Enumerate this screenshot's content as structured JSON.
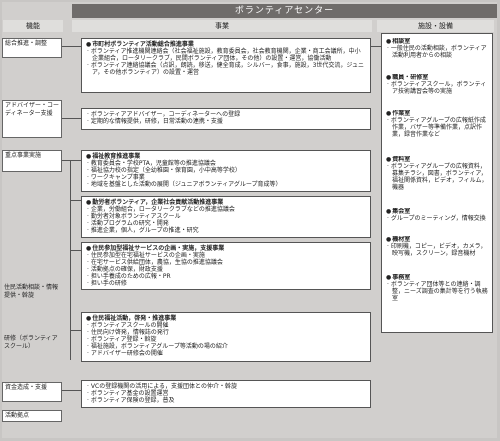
{
  "title": "ボランティアセンター",
  "headers": {
    "func": "機能",
    "business": "事業",
    "facility": "施設・設備"
  },
  "labels": {
    "coordination": "総合推進・調整",
    "advisor": "アドバイザー・コーディネーター支援",
    "priority": "重点事業実施",
    "info": "住民活動相談・情報提供・斡旋",
    "training": "研修（ボランティアスクール）",
    "funds": "資金造成・支援",
    "base": "活動拠点"
  },
  "boxes": [
    {
      "head": "市町村ボランティア活動総合推進事業",
      "items": [
        "ボランティア推進機関連絡会（社会福祉施設，教育委員会，社会教育機関，企業・商工会議所，中小企業組合，ロータリークラブ，民間ボランティア団体，その他）の設置・運営，協働活動",
        "ボランティア連絡協議会（点訳，朗読，移送，健全育成，シルバー，食事，施設，3世代交流，ジュニア，その他ボランティア）の設置・運営"
      ]
    },
    {
      "head": "",
      "items": [
        "ボランティアアドバイザー，コーディネーターへの登録",
        "定期的な情報提供，研修，日常活動の連携・支援"
      ]
    },
    {
      "head": "福祉教育推進事業",
      "items": [
        "教育委員会・学校PTA，児童館等の推進協議会",
        "福祉協力校の指定（全幼稚園・保育園，小中高等学校）",
        "ワークキャンプ事業",
        "地域を基盤とした活動の展開（ジュニアボランティアグループ育成等）"
      ]
    },
    {
      "head": "勤労者ボランティア，企業社会貢献活動推進事業",
      "items": [
        "企業，労働組合，ロータリークラブなどの推進協議会",
        "勤労者対象ボランティアスクール",
        "活動プログラムの研究・開発",
        "推進企業，個人，グループの推進・研究"
      ]
    },
    {
      "head": "住民参加型福祉サービスの企画・実施，支援事業",
      "items": [
        "住民参加型在宅福祉サービスの企画・実施",
        "在宅サービス供給団体，農協，生協の推進協議会",
        "活動拠点の確保，財政支援",
        "担い手養成のための広報・PR",
        "担い手の研修"
      ]
    },
    {
      "head": "住民福祉活動，啓発・推進事業",
      "items": [
        "ボランティアスクールの開催",
        "住民向け啓発，情報誌の発行",
        "ボランティア登録・斡旋",
        "福祉施設，ボランティアグループ等活動の場の紹介",
        "アドバイザー研修会の開催"
      ]
    },
    {
      "head": "",
      "items": [
        "VCの登録機関の活用による，支援団体との仲介・斡旋",
        "ボランティア基金の設置運営",
        "ボランティア保険の登録，普及"
      ]
    }
  ],
  "facilities": [
    {
      "head": "相談室",
      "items": [
        "一般住民の活動相談，ボランティア活動利用者からの相談"
      ]
    },
    {
      "head": "職員・研修室",
      "items": [
        "ボランティアスクール，ボランティア技術講習会等の実施"
      ]
    },
    {
      "head": "作業室",
      "items": [
        "ボランティアグループの広報紙作成作業，バザー等準備作業，点訳作業，録音作業など"
      ]
    },
    {
      "head": "資料室",
      "items": [
        "ボランティアグループの広報資料，募集チラシ，図書，ボランティア，福祉関係資料，ビデオ，フィルム，機器"
      ]
    },
    {
      "head": "集会室",
      "items": [
        "グループのミーティング，情報交換"
      ]
    },
    {
      "head": "機材室",
      "items": [
        "印刷機，コピー，ビデオ，カメラ，映写機，スクリーン，録音機材"
      ]
    },
    {
      "head": "事務室",
      "items": [
        "ボランティア団体等との連絡・調整，ニーズ調査の集計等を行う執務室"
      ]
    }
  ]
}
